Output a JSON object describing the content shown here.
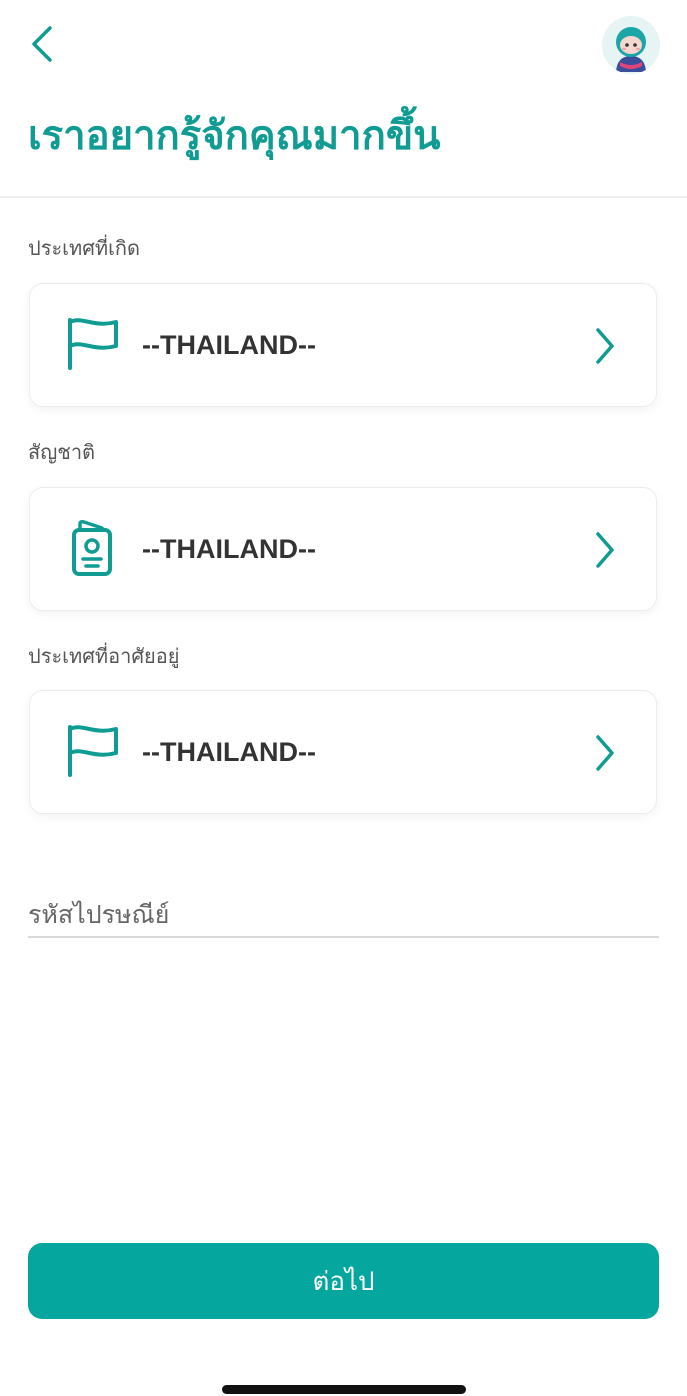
{
  "header": {
    "title": "เราอยากรู้จักคุณมากขึ้น",
    "back_icon": "chevron-left-icon",
    "avatar_icon": "avatar-icon"
  },
  "fields": [
    {
      "label": "ประเทศที่เกิด",
      "value": "--THAILAND--",
      "icon": "flag-icon"
    },
    {
      "label": "สัญชาติ",
      "value": "--THAILAND--",
      "icon": "id-card-icon"
    },
    {
      "label": "ประเทศที่อาศัยอยู่",
      "value": "--THAILAND--",
      "icon": "flag-icon"
    }
  ],
  "postal_code": {
    "placeholder": "รหัสไปรษณีย์",
    "value": ""
  },
  "next_button": {
    "label": "ต่อไป"
  },
  "colors": {
    "accent": "#109c93",
    "button": "#04a69d",
    "text": "#333333"
  }
}
